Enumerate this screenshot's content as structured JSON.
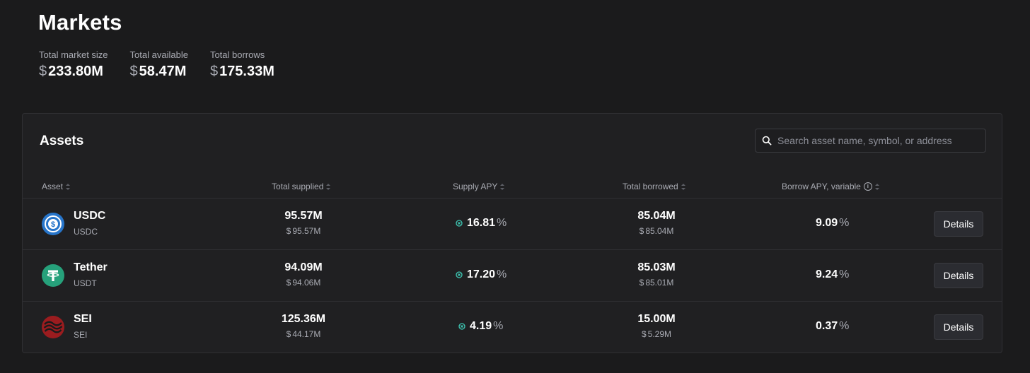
{
  "page": {
    "title": "Markets"
  },
  "stats": [
    {
      "label": "Total market size",
      "currency": "$",
      "value": "233.80M"
    },
    {
      "label": "Total available",
      "currency": "$",
      "value": "58.47M"
    },
    {
      "label": "Total borrows",
      "currency": "$",
      "value": "175.33M"
    }
  ],
  "assets_card": {
    "title": "Assets",
    "search": {
      "placeholder": "Search asset name, symbol, or address",
      "value": ""
    },
    "columns": {
      "asset": "Asset",
      "total_supplied": "Total supplied",
      "supply_apy": "Supply APY",
      "total_borrowed": "Total borrowed",
      "borrow_apy": "Borrow APY, variable"
    },
    "rows": [
      {
        "name": "USDC",
        "symbol": "USDC",
        "icon": "usdc-token-icon",
        "supplied": "95.57M",
        "supplied_usd": "95.57M",
        "supply_apy": "16.81",
        "borrowed": "85.04M",
        "borrowed_usd": "85.04M",
        "borrow_apy": "9.09",
        "details_label": "Details"
      },
      {
        "name": "Tether",
        "symbol": "USDT",
        "icon": "tether-token-icon",
        "supplied": "94.09M",
        "supplied_usd": "94.06M",
        "supply_apy": "17.20",
        "borrowed": "85.03M",
        "borrowed_usd": "85.01M",
        "borrow_apy": "9.24",
        "details_label": "Details"
      },
      {
        "name": "SEI",
        "symbol": "SEI",
        "icon": "sei-token-icon",
        "supplied": "125.36M",
        "supplied_usd": "44.17M",
        "supply_apy": "4.19",
        "borrowed": "15.00M",
        "borrowed_usd": "5.29M",
        "borrow_apy": "0.37",
        "details_label": "Details"
      }
    ],
    "currency_symbol": "$",
    "percent_symbol": "%"
  },
  "colors": {
    "background": "#1b1b1c",
    "card": "#202022",
    "incentive_teal": "#3ec7b4",
    "usdc_blue": "#2775ca",
    "tether_green": "#26a17b",
    "sei_red": "#9b1c1f"
  }
}
